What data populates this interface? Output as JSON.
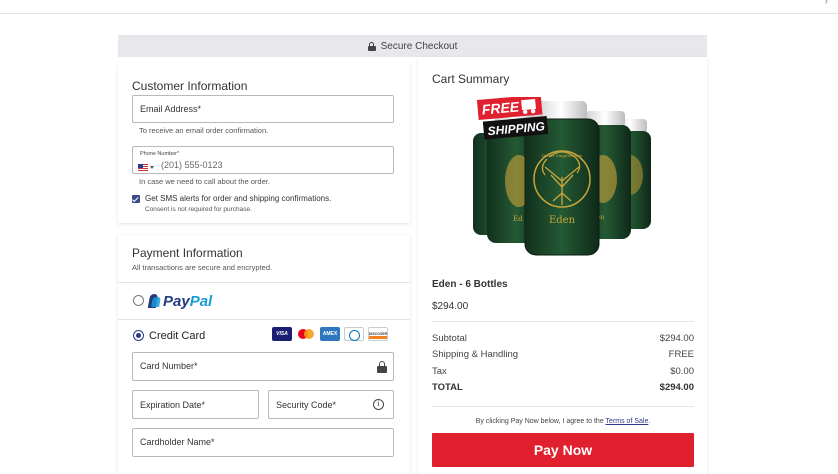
{
  "header": {
    "secure_checkout": "Secure Checkout"
  },
  "customer": {
    "title": "Customer Information",
    "email_label": "Email Address*",
    "email_hint": "To receive an email order confirmation.",
    "phone_label": "Phone Number*",
    "phone_placeholder": "(201) 555-0123",
    "phone_hint": "In case we need to call about the order.",
    "sms_label": "Get SMS alerts for order and shipping confirmations.",
    "sms_note": "Consent is not required for purchase.",
    "sms_checked": true
  },
  "payment": {
    "title": "Payment Information",
    "subtitle": "All transactions are secure and encrypted.",
    "paypal_label_1": "Pay",
    "paypal_label_2": "Pal",
    "credit_card_label": "Credit Card",
    "selected_method": "Credit Card",
    "card_brands": [
      "VISA",
      "Mastercard",
      "AMEX",
      "Diners Club",
      "DISCOVER"
    ],
    "card_number_label": "Card Number*",
    "expiration_label": "Expiration Date*",
    "security_code_label": "Security Code*",
    "cardholder_label": "Cardholder Name*"
  },
  "cart": {
    "title": "Cart Summary",
    "badge_free": "FREE",
    "badge_shipping": "SHIPPING",
    "product_brand": "Eden",
    "product_name": "Eden - 6 Bottles",
    "product_price": "$294.00",
    "subtotal_label": "Subtotal",
    "subtotal_value": "$294.00",
    "shipping_label": "Shipping & Handling",
    "shipping_value": "FREE",
    "tax_label": "Tax",
    "tax_value": "$0.00",
    "total_label": "TOTAL",
    "total_value": "$294.00",
    "terms_prefix": "By clicking Pay Now below, I agree to the",
    "terms_link": "Terms of Sale",
    "terms_suffix": ".",
    "pay_button": "Pay Now"
  },
  "colors": {
    "accent_blue": "#2b3a8a",
    "pay_red": "#e0202e",
    "bottle_green": "#1e4a2c",
    "gold": "#c9a43a"
  }
}
